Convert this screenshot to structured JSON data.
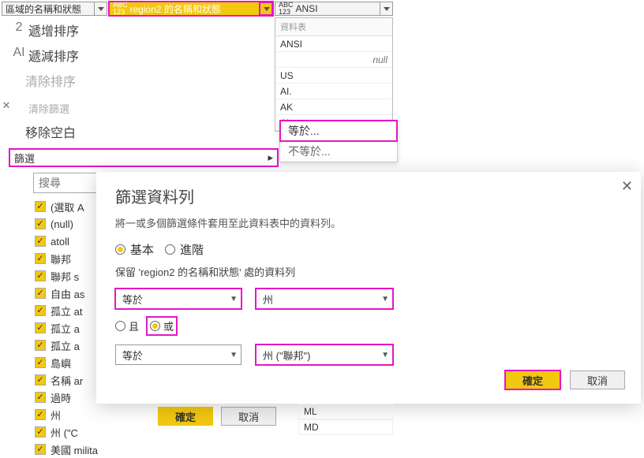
{
  "columns": {
    "col1": "區域的名稱和狀態",
    "col2": "region2 的名稱和狀態",
    "col3": "ANSI",
    "prefix123_a": "ABC",
    "prefix123_b": "123"
  },
  "context_menu": {
    "sort_asc_icon": "2",
    "sort_asc": "遞增排序",
    "sort_desc_icon": "AI",
    "sort_desc": "遞減排序",
    "clear_sort": "清除排序",
    "clear_filter": "清除篩選",
    "remove_blank": "移除空白",
    "filter_label": "篩選"
  },
  "search": {
    "placeholder": "搜尋"
  },
  "checklist": [
    "(選取 A",
    "(null)",
    "atoll",
    "聯邦",
    "聯邦 s",
    "自由 as",
    "孤立 at",
    "孤立 a",
    "孤立 a",
    "島嶼",
    "名稱 ar",
    "過時",
    "州",
    "州 (\"C",
    "美國 milita"
  ],
  "ctx_buttons": {
    "ok": "確定",
    "cancel": "取消"
  },
  "preview": {
    "header": "資料表",
    "rows": [
      "ANSI",
      "null",
      "US",
      "AI.",
      "AK",
      "AI"
    ],
    "lower_rows": [
      "ML",
      "MD"
    ]
  },
  "flyout": {
    "eq": "等於...",
    "neq": "不等於..."
  },
  "dialog": {
    "title": "篩選資料列",
    "subtitle": "將一或多個篩選條件套用至此資料表中的資料列。",
    "basic": "基本",
    "advanced": "進階",
    "keep": "保留 'region2 的名稱和狀態' 處的資料列",
    "op1": "等於",
    "val1": "州",
    "and": "且",
    "or": "或",
    "op2": "等於",
    "val2": "州 (\"聯邦\")",
    "ok": "確定",
    "cancel": "取消"
  }
}
